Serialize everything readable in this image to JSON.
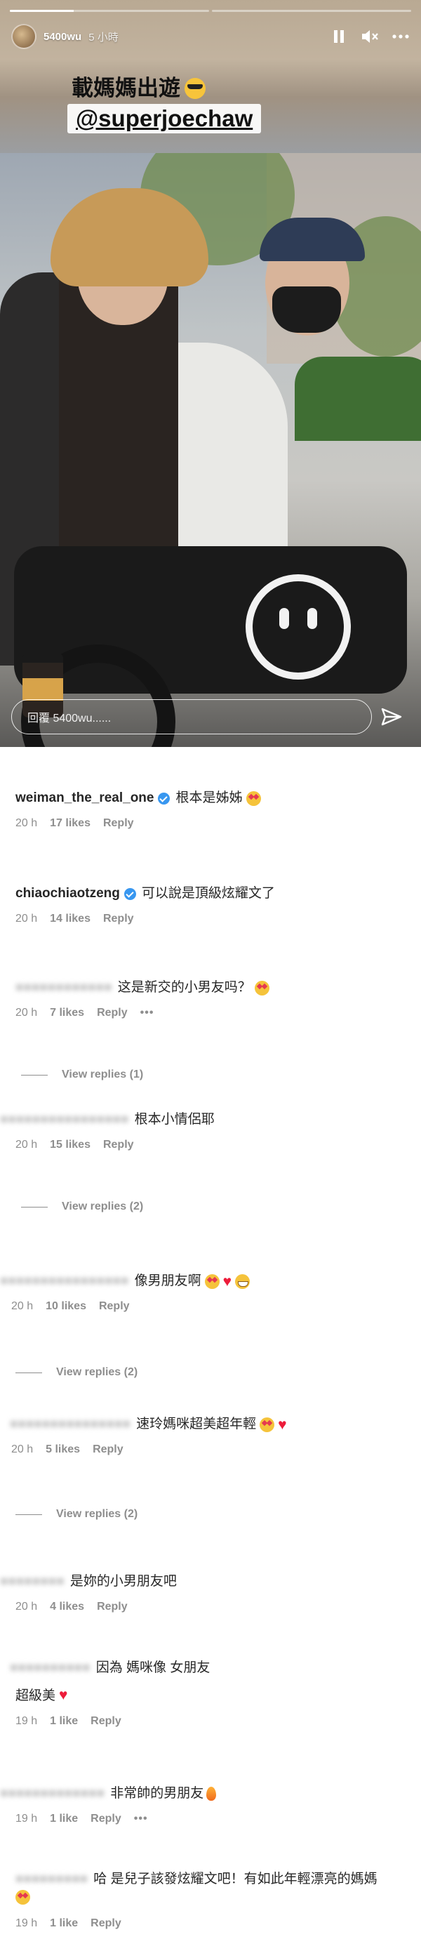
{
  "story": {
    "username": "5400wu",
    "time": "5 小時",
    "progress_fraction": 0.16,
    "caption_line1": "載媽媽出遊",
    "caption_mention": "@superjoechaw",
    "reply_placeholder": "回覆 5400wu......"
  },
  "comments": [
    {
      "user": "weiman_the_real_one",
      "verified": true,
      "blurred": false,
      "text": "根本是姊姊",
      "time": "20 h",
      "likes": "17 likes",
      "reply": "Reply"
    },
    {
      "user": "chiaochiaotzeng",
      "verified": true,
      "blurred": false,
      "text": "可以說是頂級炫耀文了",
      "time": "20 h",
      "likes": "14 likes",
      "reply": "Reply"
    },
    {
      "user": "",
      "verified": false,
      "blurred": true,
      "text": "这是新交的小男友吗？",
      "time": "20 h",
      "likes": "7 likes",
      "reply": "Reply",
      "more": "•••",
      "view_replies": "View replies (1)"
    },
    {
      "user": "",
      "verified": false,
      "blurred": true,
      "text": "根本小情侶耶",
      "time": "20 h",
      "likes": "15 likes",
      "reply": "Reply",
      "view_replies": "View replies (2)"
    },
    {
      "user": "",
      "verified": false,
      "blurred": true,
      "text": "像男朋友啊",
      "time": "20 h",
      "likes": "10 likes",
      "reply": "Reply",
      "view_replies": "View replies (2)"
    },
    {
      "user": "",
      "verified": false,
      "blurred": true,
      "text": "速玲媽咪超美超年輕",
      "time": "20 h",
      "likes": "5 likes",
      "reply": "Reply",
      "view_replies": "View replies (2)"
    },
    {
      "user": "",
      "verified": false,
      "blurred": true,
      "text": "是妳的小男朋友吧",
      "time": "20 h",
      "likes": "4 likes",
      "reply": "Reply"
    },
    {
      "user": "",
      "verified": false,
      "blurred": true,
      "text": "因為 媽咪像 女朋友",
      "text2": "超級美",
      "time": "19 h",
      "likes": "1 like",
      "reply": "Reply"
    },
    {
      "user": "",
      "verified": false,
      "blurred": true,
      "text": "非常帥的男朋友",
      "time": "19 h",
      "likes": "1 like",
      "reply": "Reply",
      "more": "•••"
    },
    {
      "user": "",
      "verified": false,
      "blurred": true,
      "text": "哈 是兒子該發炫耀文吧！有如此年輕漂亮的媽媽",
      "time": "19 h",
      "likes": "1 like",
      "reply": "Reply"
    }
  ]
}
